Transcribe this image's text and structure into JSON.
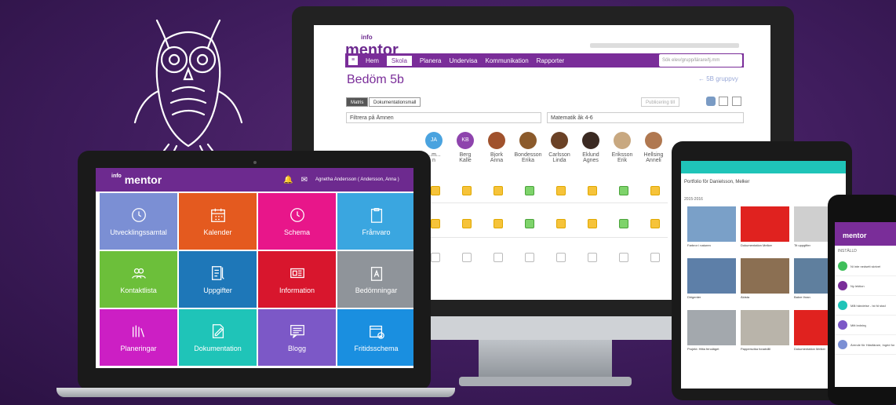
{
  "monitor": {
    "logo": {
      "top": "info",
      "bottom": "mentor"
    },
    "nav": {
      "menu_icon": "menu-icon",
      "items": [
        "Hem",
        "Skola",
        "Planera",
        "Undervisa",
        "Kommunikation",
        "Rapporter"
      ],
      "active": "Skola"
    },
    "search_placeholder": "Sök elev/grupp/lärare/tj.mm",
    "page_title": "Bedöm 5b",
    "back_link": "5B gruppvy",
    "view_tabs": [
      "Matris",
      "Dokumentationsmall"
    ],
    "publish_label": "Publicering till",
    "filter_subject": "Filtrera på Ämnen",
    "subject_select": "Matematik åk 4-6",
    "students": [
      {
        "initials": "JA",
        "first": "...m...",
        "last": "n",
        "color": "#4aa3df"
      },
      {
        "initials": "KB",
        "first": "Berg",
        "last": "Kalle",
        "color": "#8e44ad"
      },
      {
        "initials": "",
        "first": "Bjork",
        "last": "Anna",
        "color": "#a0522d"
      },
      {
        "initials": "",
        "first": "Bondesson",
        "last": "Erika",
        "color": "#8b5a2b"
      },
      {
        "initials": "",
        "first": "Carlsson",
        "last": "Linda",
        "color": "#6b4226"
      },
      {
        "initials": "",
        "first": "Eklund",
        "last": "Agnes",
        "color": "#3b2a22"
      },
      {
        "initials": "",
        "first": "Eriksson",
        "last": "Erik",
        "color": "#c8a880"
      },
      {
        "initials": "",
        "first": "Hellsing",
        "last": "Anneli",
        "color": "#b07850"
      }
    ]
  },
  "laptop": {
    "logo": {
      "top": "info",
      "bottom": "mentor"
    },
    "user": "Agnetha Andersson ( Andersson, Anna )",
    "tiles": [
      {
        "label": "Utvecklingssamtal",
        "color": "#7b8fd4",
        "icon": "clock-icon"
      },
      {
        "label": "Kalender",
        "color": "#e45a1f",
        "icon": "calendar-icon"
      },
      {
        "label": "Schema",
        "color": "#e8168a",
        "icon": "clock-icon"
      },
      {
        "label": "Frånvaro",
        "color": "#3aa6e0",
        "icon": "clipboard-icon"
      },
      {
        "label": "Kontaktlista",
        "color": "#6cbf3a",
        "icon": "contacts-icon"
      },
      {
        "label": "Uppgifter",
        "color": "#1e77b8",
        "icon": "task-icon"
      },
      {
        "label": "Information",
        "color": "#d8162d",
        "icon": "news-icon"
      },
      {
        "label": "Bedömningar",
        "color": "#8f949a",
        "icon": "assessment-icon"
      },
      {
        "label": "Planeringar",
        "color": "#cc1fc4",
        "icon": "books-icon"
      },
      {
        "label": "Dokumentation",
        "color": "#1fc4b8",
        "icon": "document-icon"
      },
      {
        "label": "Blogg",
        "color": "#7c58c7",
        "icon": "blog-icon"
      },
      {
        "label": "Fritidsschema",
        "color": "#1a8fe0",
        "icon": "calendar-check-icon"
      }
    ]
  },
  "tablet": {
    "title": "Portfolio för Danielsson, Melker",
    "date_label": "2015-2016",
    "captions": [
      "Farbror i naturen",
      "Dokumentation Melker",
      "Tit uppgifter",
      "Dirigenter",
      "Äldsta",
      "Bakre Ihran",
      "Projekt: Hitta fenoläget",
      "Pappersvika fonatvåll",
      "Dokumentation Melker"
    ]
  },
  "phone": {
    "logo": {
      "top": "info",
      "bottom": "mentor"
    },
    "section": "INSTÄLLD",
    "items": [
      "Ni inte nedsett skrivet",
      "Ny lektion",
      "Mål händelse - Ist fd stad",
      "Mitt ledning",
      "Ärende för Hästlärare, Ingrid form"
    ]
  }
}
